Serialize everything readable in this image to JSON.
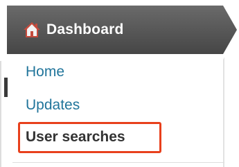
{
  "menu": {
    "header": {
      "label": "Dashboard",
      "icon": "home-icon"
    },
    "items": [
      {
        "label": "Home",
        "state": "link"
      },
      {
        "label": "Updates",
        "state": "link"
      },
      {
        "label": "User searches",
        "state": "current",
        "highlighted": true
      }
    ]
  },
  "colors": {
    "header_bg": "#4e4e4e",
    "link": "#21759b",
    "current_text": "#333333",
    "highlight_border": "#e8401c",
    "home_icon_roof": "#c44b3d"
  }
}
